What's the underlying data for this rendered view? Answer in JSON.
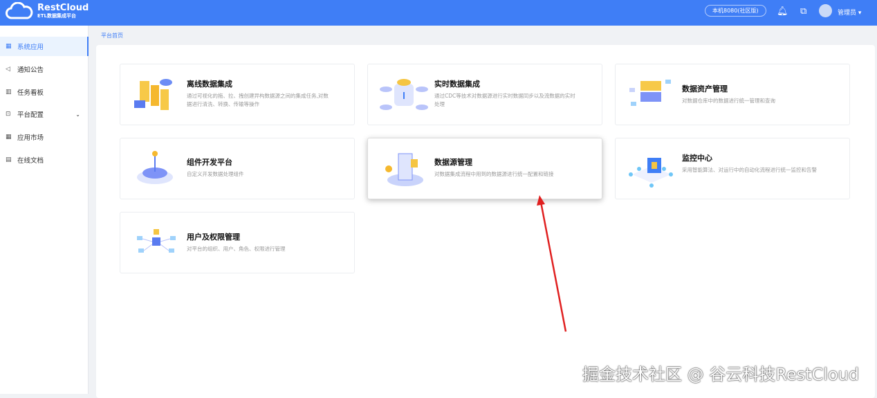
{
  "header": {
    "brand": "RestCloud",
    "subtitle": "ETL数据集成平台",
    "env": "本机8080(社区版)",
    "user": "管理员"
  },
  "sidebar": {
    "items": [
      {
        "label": "系统应用",
        "icon": "grid-icon"
      },
      {
        "label": "通知公告",
        "icon": "megaphone-icon"
      },
      {
        "label": "任务看板",
        "icon": "board-icon"
      },
      {
        "label": "平台配置",
        "icon": "terminal-icon"
      },
      {
        "label": "应用市场",
        "icon": "apps-icon"
      },
      {
        "label": "在线文档",
        "icon": "document-icon"
      }
    ]
  },
  "breadcrumb": "平台首页",
  "cards": [
    {
      "title": "离线数据集成",
      "desc": "通过可视化的拖、拉、拽创建异构数据源之间的集成任务,对数据进行清洗、转换、传输等操作"
    },
    {
      "title": "实时数据集成",
      "desc": "通过CDC等技术对数据源进行实时数据同步以及流数据的实时处理"
    },
    {
      "title": "数据资产管理",
      "desc": "对数据仓库中的数据进行统一管理和查询"
    },
    {
      "title": "组件开发平台",
      "desc": "自定义开发数据处理组件"
    },
    {
      "title": "数据源管理",
      "desc": "对数据集成流程中用到的数据源进行统一配置和链接"
    },
    {
      "title": "监控中心",
      "desc": "采用智能算法、对运行中的自动化流程进行统一监控和告警"
    },
    {
      "title": "用户及权限管理",
      "desc": "对平台的组织、用户、角色、权限进行管理"
    }
  ],
  "watermark": "掘金技术社区 @ 谷云科技RestCloud",
  "colors": {
    "primary": "#3f7ef6",
    "arrow": "#e02020"
  }
}
